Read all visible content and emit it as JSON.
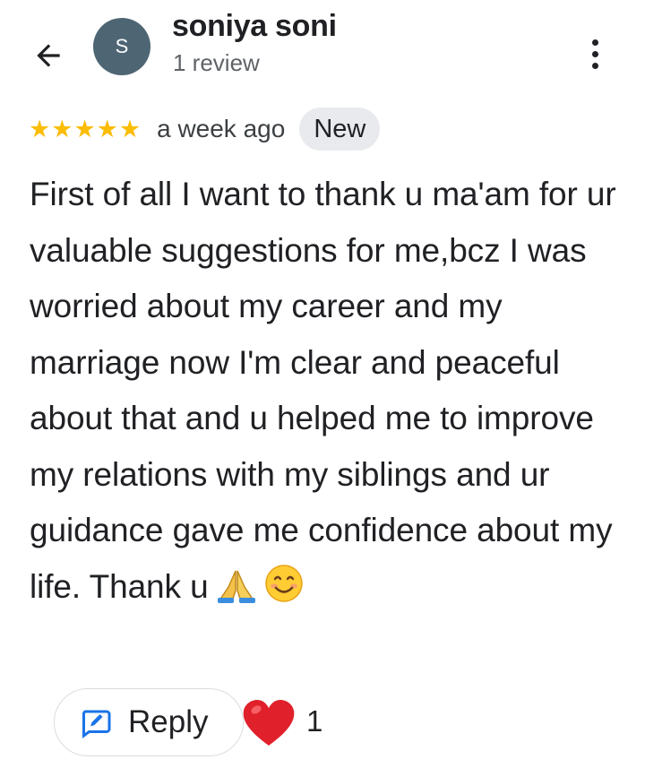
{
  "header": {
    "back_icon": "arrow-left-icon",
    "avatar_letter": "S",
    "reviewer_name": "soniya soni",
    "review_count": "1 review",
    "more_icon": "more-vert-icon"
  },
  "review": {
    "rating": 5,
    "rating_max": 5,
    "time_ago": "a week ago",
    "badge": "New",
    "text": "First of all I want to thank u ma'am for ur valuable suggestions for me,bcz I was worried about my career and my marriage now I'm clear and peaceful about that and u helped me to improve my relations with my siblings and ur guidance gave me confidence about my life. Thank u",
    "emojis": [
      "folded-hands-icon",
      "smiling-face-icon"
    ]
  },
  "actions": {
    "reply_label": "Reply",
    "reply_icon": "reply-edit-icon",
    "like_icon": "heart-icon",
    "like_count": "1"
  },
  "colors": {
    "star": "#fbbc04",
    "avatar_bg": "#4e6574",
    "badge_bg": "#e8eaed",
    "reply_icon": "#1a73e8",
    "heart": "#e0202a"
  }
}
